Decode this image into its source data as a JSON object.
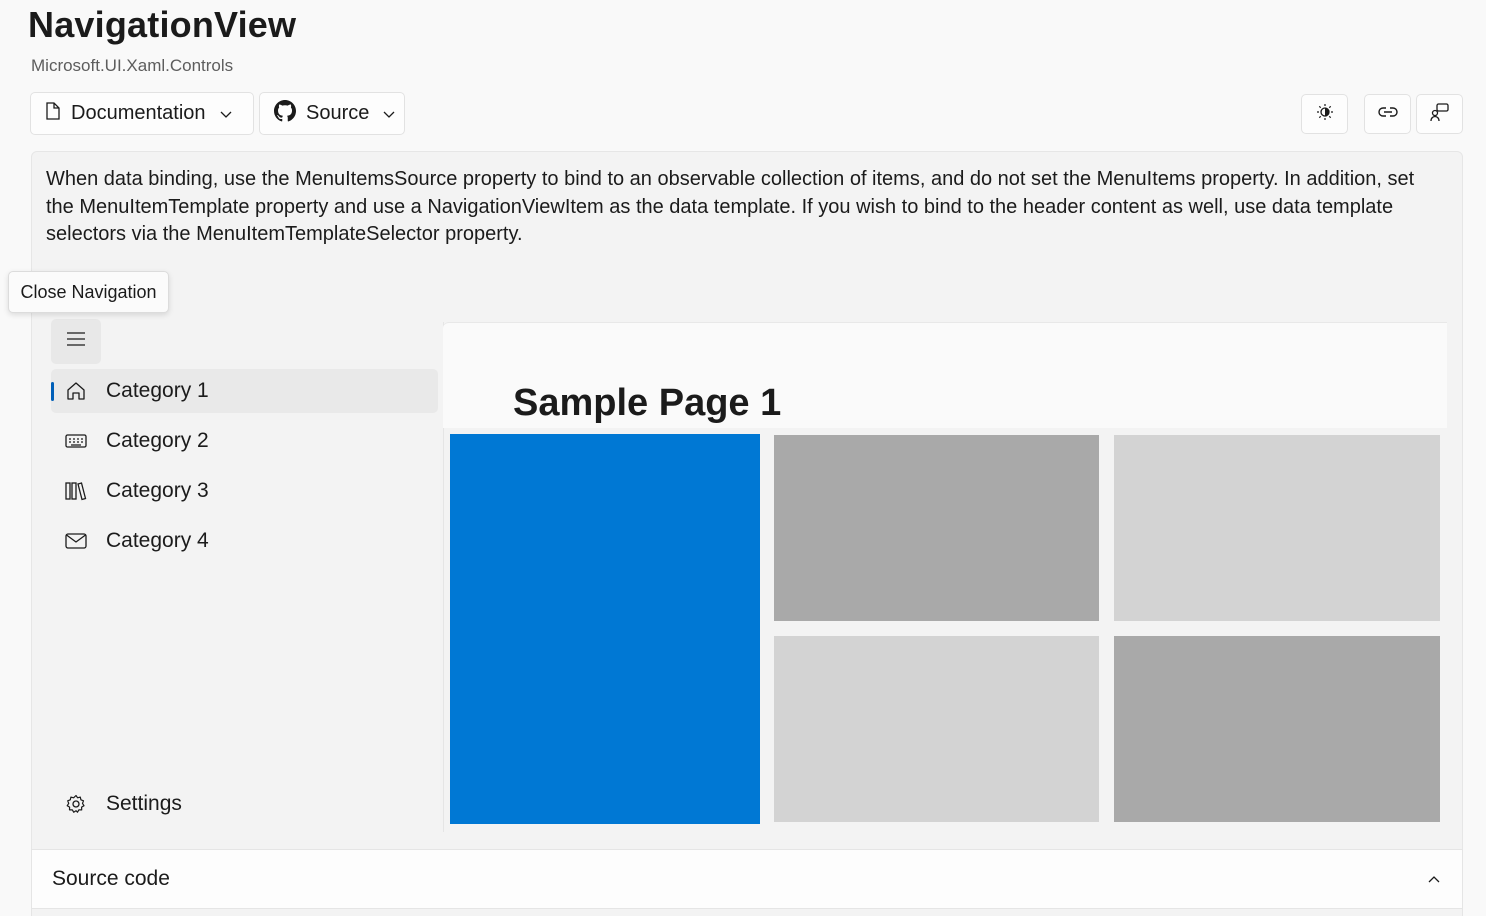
{
  "page": {
    "title": "NavigationView",
    "subtitle": "Microsoft.UI.Xaml.Controls"
  },
  "toolbar": {
    "documentation_label": "Documentation",
    "source_label": "Source",
    "icons": [
      "theme-toggle-icon",
      "link-icon",
      "feedback-icon"
    ]
  },
  "description": "When data binding, use the MenuItemsSource property to bind to an observable collection of items, and do not set the MenuItems property. In addition, set the MenuItemTemplate property and use a NavigationViewItem as the data template. If you wish to bind to the header content as well, use data template selectors via the MenuItemTemplateSelector property.",
  "tooltip": "Close Navigation",
  "nav": {
    "items": [
      {
        "label": "Category 1",
        "icon": "home-icon",
        "selected": true
      },
      {
        "label": "Category 2",
        "icon": "keyboard-icon",
        "selected": false
      },
      {
        "label": "Category 3",
        "icon": "library-icon",
        "selected": false
      },
      {
        "label": "Category 4",
        "icon": "mail-icon",
        "selected": false
      }
    ],
    "settings_label": "Settings"
  },
  "content": {
    "heading": "Sample Page 1",
    "tile_colors": {
      "accent": "#0078d4",
      "dark_gray": "#a9a9a9",
      "light_gray": "#d3d3d3"
    }
  },
  "source_code": {
    "label": "Source code"
  }
}
